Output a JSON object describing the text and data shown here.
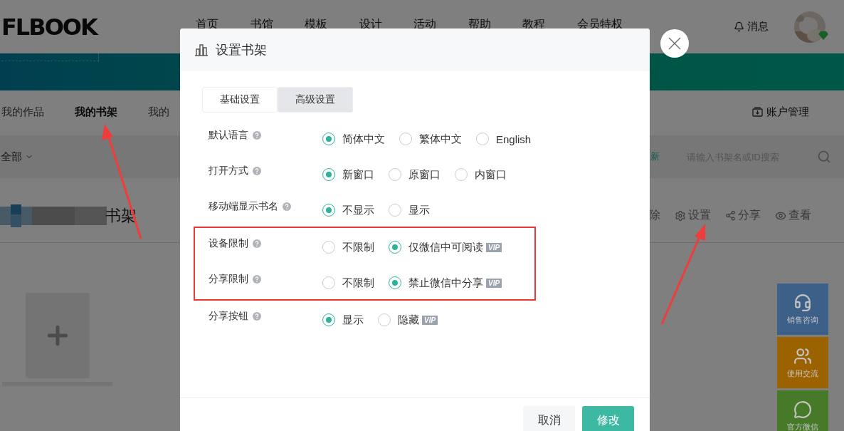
{
  "header": {
    "logo": "FLBOOK",
    "nav": [
      "首页",
      "书馆",
      "模板",
      "设计",
      "活动",
      "帮助",
      "教程",
      "会员特权"
    ],
    "messages": "消息"
  },
  "subnav": {
    "tabs": [
      {
        "label": "我的作品",
        "selected": false
      },
      {
        "label": "我的书架",
        "selected": true
      },
      {
        "label": "我的",
        "selected": false
      }
    ],
    "account": "账户管理"
  },
  "filter": {
    "category": "全部",
    "sort_link": "新",
    "search": {
      "placeholder": "请输入书架名或ID搜索"
    }
  },
  "shelf": {
    "title": "书架",
    "actions": [
      {
        "label": "除",
        "kind": "delete"
      },
      {
        "label": "设置",
        "kind": "settings"
      },
      {
        "label": "分享",
        "kind": "share"
      },
      {
        "label": "查看",
        "kind": "view"
      }
    ]
  },
  "side_buttons": [
    {
      "label": "销售咨询",
      "kind": "support",
      "color": "#3c6088"
    },
    {
      "label": "使用交流",
      "kind": "community",
      "color": "#9c6200"
    },
    {
      "label": "官方微信",
      "kind": "wechat",
      "color": "#467a28"
    }
  ],
  "dialog": {
    "title": "设置书架",
    "tabs": [
      {
        "label": "基础设置",
        "selected": false
      },
      {
        "label": "高级设置",
        "selected": true
      }
    ],
    "setting_groups": [
      {
        "highlighted": false,
        "rows": [
          {
            "label": "默认语言",
            "options": [
              {
                "label": "简体中文",
                "selected": true
              },
              {
                "label": "繁体中文",
                "selected": false
              },
              {
                "label": "English",
                "selected": false
              }
            ]
          },
          {
            "label": "打开方式",
            "options": [
              {
                "label": "新窗口",
                "selected": true
              },
              {
                "label": "原窗口",
                "selected": false
              },
              {
                "label": "内窗口",
                "selected": false
              }
            ]
          },
          {
            "label": "移动端显示书名",
            "options": [
              {
                "label": "不显示",
                "selected": true
              },
              {
                "label": "显示",
                "selected": false
              }
            ]
          }
        ]
      },
      {
        "highlighted": true,
        "rows": [
          {
            "label": "设备限制",
            "options": [
              {
                "label": "不限制",
                "selected": false
              },
              {
                "label": "仅微信中可阅读",
                "selected": true,
                "badge": "VIP"
              }
            ]
          },
          {
            "label": "分享限制",
            "options": [
              {
                "label": "不限制",
                "selected": false
              },
              {
                "label": "禁止微信中分享",
                "selected": true,
                "badge": "VIP"
              }
            ]
          }
        ]
      },
      {
        "highlighted": false,
        "rows": [
          {
            "label": "分享按钮",
            "options": [
              {
                "label": "显示",
                "selected": true
              },
              {
                "label": "隐藏",
                "selected": false,
                "badge": "VIP"
              }
            ]
          }
        ]
      }
    ],
    "buttons": [
      {
        "label": "取消",
        "kind": "secondary"
      },
      {
        "label": "修改",
        "kind": "primary"
      }
    ]
  }
}
